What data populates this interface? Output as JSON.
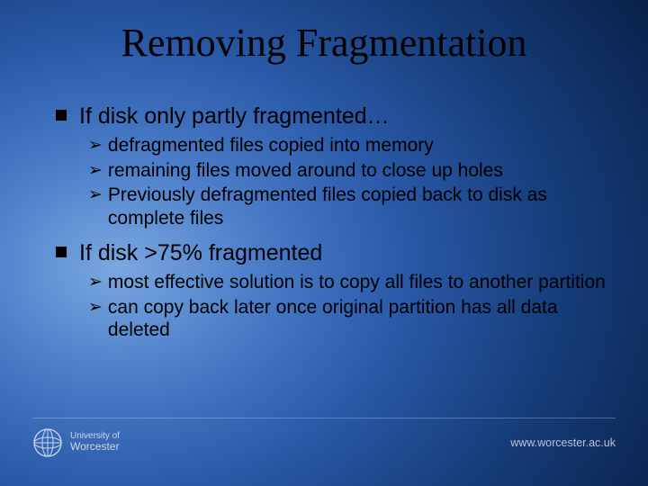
{
  "title": "Removing Fragmentation",
  "bullets": [
    {
      "text": "If disk only partly fragmented…",
      "sub": [
        "defragmented files copied into memory",
        "remaining files moved around to close up holes",
        "Previously defragmented files copied back to disk as complete files"
      ]
    },
    {
      "text": "If disk >75% fragmented",
      "sub": [
        "most effective solution is to copy all files to another partition",
        "can copy back later once original partition has all data deleted"
      ]
    }
  ],
  "footer": {
    "uni_line1": "University of",
    "uni_line2": "Worcester",
    "url": "www.worcester.ac.uk"
  },
  "colors": {
    "text": "#000000",
    "footer_text": "#cfd8ea"
  }
}
